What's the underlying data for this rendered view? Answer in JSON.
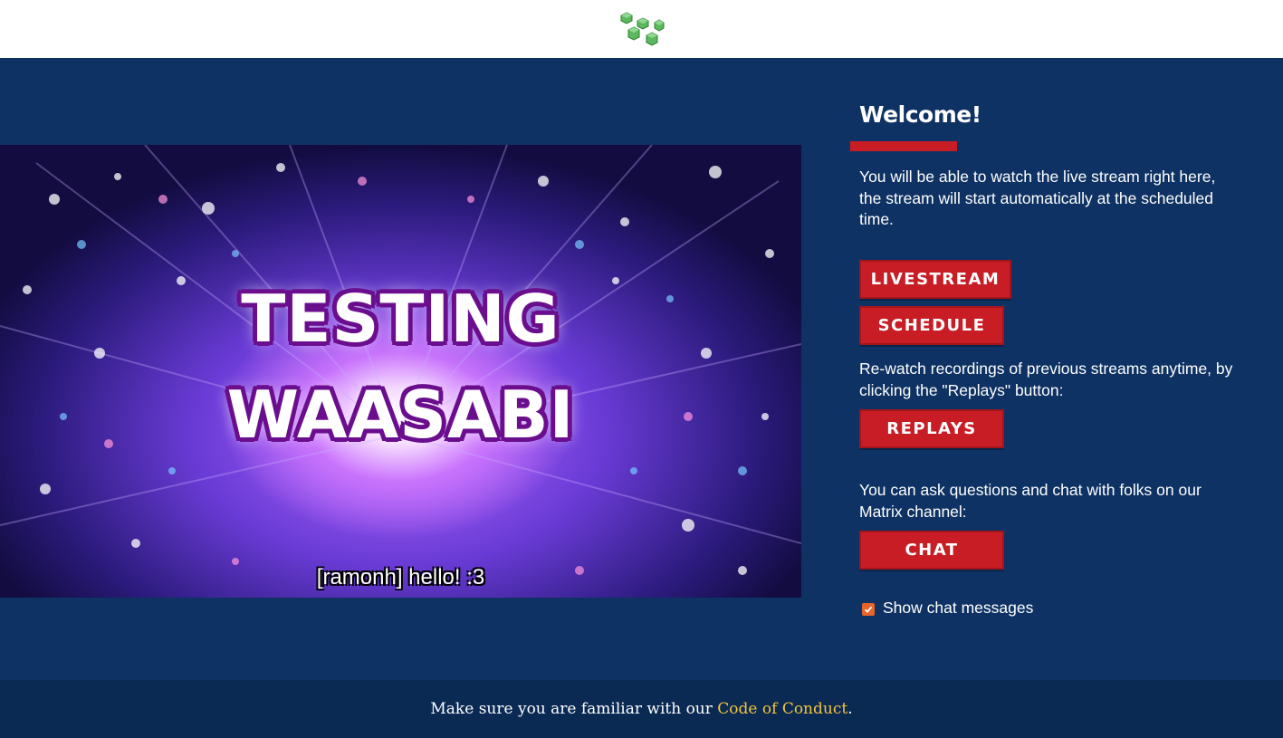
{
  "header": {
    "logo_icon": "green-cubes-logo-icon"
  },
  "video": {
    "title_line1": "TESTING",
    "title_line2": "WAASABI",
    "subtitle": "[ramonh] hello! :3"
  },
  "sidebar": {
    "heading": "Welcome!",
    "intro": "You will be able to watch the live stream right here, the stream will start automatically at the scheduled time.",
    "livestream_label": "LIVESTREAM",
    "schedule_label": "SCHEDULE",
    "replays_text": "Re-watch recordings of previous streams anytime, by clicking the \"Replays\" button:",
    "replays_label": "REPLAYS",
    "chat_text": "You can ask questions and chat with folks on our Matrix channel:",
    "chat_label": "CHAT",
    "show_chat": {
      "label": "Show chat messages",
      "checked": true
    }
  },
  "footer": {
    "prefix": "Make sure you are familiar with our ",
    "link_text": "Code of Conduct",
    "suffix": "."
  },
  "colors": {
    "background": "#0e3263",
    "accent_red": "#c81d25",
    "link_yellow": "#f5c43b",
    "checkbox_orange": "#e8642a",
    "logo_green": "#5cb85c"
  }
}
